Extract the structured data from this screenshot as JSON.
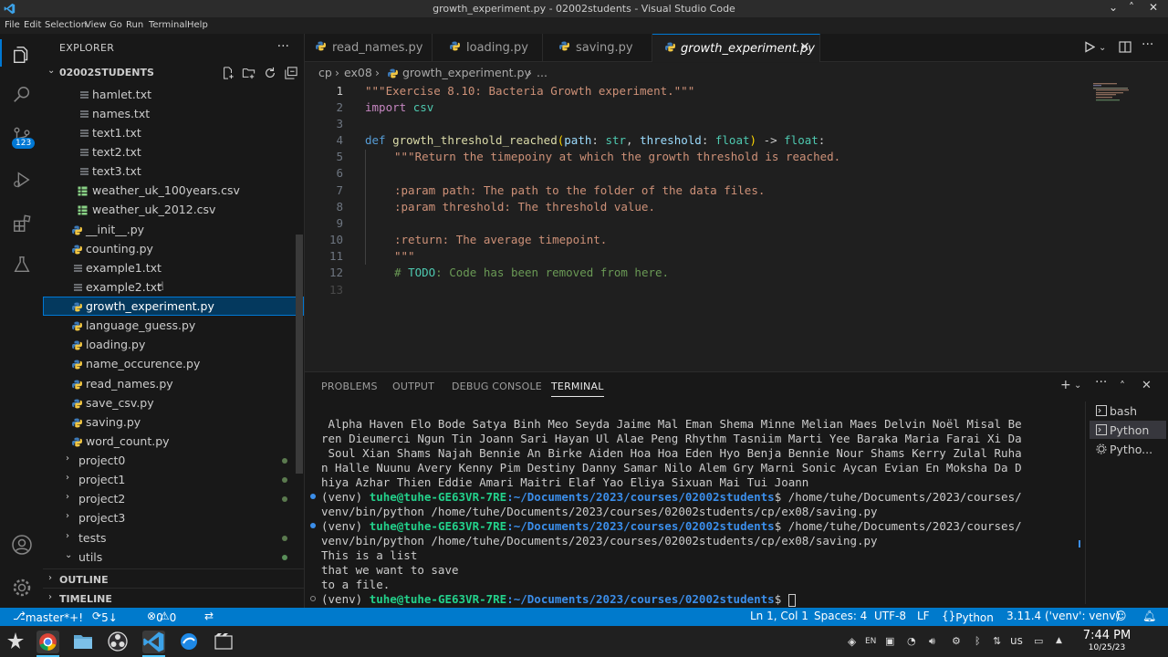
{
  "titlebar": {
    "title": "growth_experiment.py - 02002students - Visual Studio Code"
  },
  "menu": [
    "File",
    "Edit",
    "Selection",
    "View",
    "Go",
    "Run",
    "Terminal",
    "Help"
  ],
  "activity": {
    "scm_badge": "123",
    "settings_badge": "1"
  },
  "explorer": {
    "header": "EXPLORER",
    "folder": "02002STUDENTS",
    "files": [
      {
        "label": "hamlet.txt",
        "icon": "text-file-icon"
      },
      {
        "label": "names.txt",
        "icon": "text-file-icon"
      },
      {
        "label": "text1.txt",
        "icon": "text-file-icon"
      },
      {
        "label": "text2.txt",
        "icon": "text-file-icon"
      },
      {
        "label": "text3.txt",
        "icon": "text-file-icon"
      },
      {
        "label": "weather_uk_100years.csv",
        "icon": "csv-file-icon"
      },
      {
        "label": "weather_uk_2012.csv",
        "icon": "csv-file-icon"
      },
      {
        "label": "__init__.py",
        "icon": "python-file-icon"
      },
      {
        "label": "counting.py",
        "icon": "python-file-icon"
      },
      {
        "label": "example1.txt",
        "icon": "text-file-icon"
      },
      {
        "label": "example2.txt",
        "icon": "text-file-icon"
      },
      {
        "label": "growth_experiment.py",
        "icon": "python-file-icon"
      },
      {
        "label": "language_guess.py",
        "icon": "python-file-icon"
      },
      {
        "label": "loading.py",
        "icon": "python-file-icon"
      },
      {
        "label": "name_occurence.py",
        "icon": "python-file-icon"
      },
      {
        "label": "read_names.py",
        "icon": "python-file-icon"
      },
      {
        "label": "save_csv.py",
        "icon": "python-file-icon"
      },
      {
        "label": "saving.py",
        "icon": "python-file-icon"
      },
      {
        "label": "word_count.py",
        "icon": "python-file-icon"
      }
    ],
    "folders": [
      "project0",
      "project1",
      "project2",
      "project3",
      "tests",
      "utils"
    ],
    "outline": "OUTLINE",
    "timeline": "TIMELINE"
  },
  "tabs": [
    {
      "label": "read_names.py"
    },
    {
      "label": "loading.py"
    },
    {
      "label": "saving.py"
    },
    {
      "label": "growth_experiment.py"
    }
  ],
  "breadcrumb": [
    "cp",
    "ex08",
    "growth_experiment.py",
    "..."
  ],
  "editor": {
    "line_numbers": [
      "1",
      "2",
      "3",
      "4",
      "5",
      "6",
      "7",
      "8",
      "9",
      "10",
      "11",
      "12",
      "13"
    ],
    "lines": {
      "l1": "\"\"\"Exercise 8.10: Bacteria Growth experiment.\"\"\"",
      "l2_kw": "import",
      "l2_mod": "csv",
      "l4_def": "def",
      "l4_fn": "growth_threshold_reached",
      "l4_p1": "path",
      "l4_t1": "str",
      "l4_p2": "threshold",
      "l4_t2": "float",
      "l4_ret": "float",
      "l5": "\"\"\"Return the timepoiny at which the growth threshold is reached.",
      "l7": ":param path: The path to the folder of the data files.",
      "l8": ":param threshold: The threshold value.",
      "l10": ":return: The average timepoint.",
      "l11": "\"\"\"",
      "l12_hash": "# ",
      "l12_todo": "TODO",
      "l12_rest": ": Code has been removed from here."
    }
  },
  "panel": {
    "tabs": [
      "PROBLEMS",
      "OUTPUT",
      "DEBUG CONSOLE",
      "TERMINAL"
    ],
    "terminal": {
      "names": [
        " Alpha Haven Elo Bode Satya Binh Meo Seyda Jaime Mal Eman Shema Minne Melian Maes Delvin Noël Misal Be",
        "ren Dieumerci Ngun Tin Joann Sari Hayan Ul Alae Peng Rhythm Tasniim Marti Yee Baraka Maria Farai Xi Da",
        " Soul Xian Shams Najah Bennie An Birke Aiden Hoa Hoa Eden Hyo Benja Bennie Nour Shams Kerry Zulal Ruha",
        "n Halle Nuunu Avery Kenny Pim Destiny Danny Samar Nilo Alem Gry Marni Sonic Aycan Evian En Moksha Da D",
        "hiya Azhar Thien Eddie Amari Maitri Elaf Yao Eliya Sixuan Mai Tui Joann"
      ],
      "venv": "(venv) ",
      "user": "tuhe@tuhe-GE63VR-7RE",
      "path": ":~/Documents/2023/courses/02002students",
      "cmd1a": "$ /home/tuhe/Documents/2023/courses/",
      "cmd1b": "venv/bin/python /home/tuhe/Documents/2023/courses/02002students/cp/ex08/saving.py",
      "out": [
        "This is a list",
        "that we want to save",
        "to a file."
      ],
      "prompt_end": "$ "
    },
    "terminals": [
      "bash",
      "Python",
      "Pytho..."
    ]
  },
  "statusbar": {
    "branch": "master*+!",
    "sync": "5↓ 1↑",
    "errors": "0",
    "warnings": "0",
    "position": "Ln 1, Col 1",
    "spaces": "Spaces: 4",
    "encoding": "UTF-8",
    "eol": "LF",
    "language": "Python",
    "interpreter": "3.11.4 ('venv': venv)"
  },
  "taskbar": {
    "time": "7:44 PM",
    "date": "10/25/23",
    "lang": "EN",
    "kb": "us"
  },
  "colors": {
    "accent": "#0078d4",
    "statusbar": "#007acc",
    "selection": "#04395e"
  }
}
